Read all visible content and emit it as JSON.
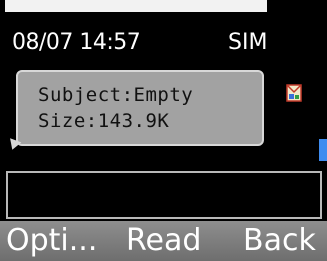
{
  "status": {
    "datetime": "08/07 14:57",
    "sim": "SIM"
  },
  "message_tooltip": {
    "subject": "Subject:Empty",
    "size": "Size:143.9K"
  },
  "icons": {
    "message_type": "mms-message-icon"
  },
  "softkeys": {
    "left": "Opti...",
    "center": "Read",
    "right": "Back"
  },
  "colors": {
    "background": "#000000",
    "tooltip_bg": "#a2a2a2",
    "softkey_bar": "#7e7e7e",
    "scroll_thumb": "#3f8cf0"
  }
}
